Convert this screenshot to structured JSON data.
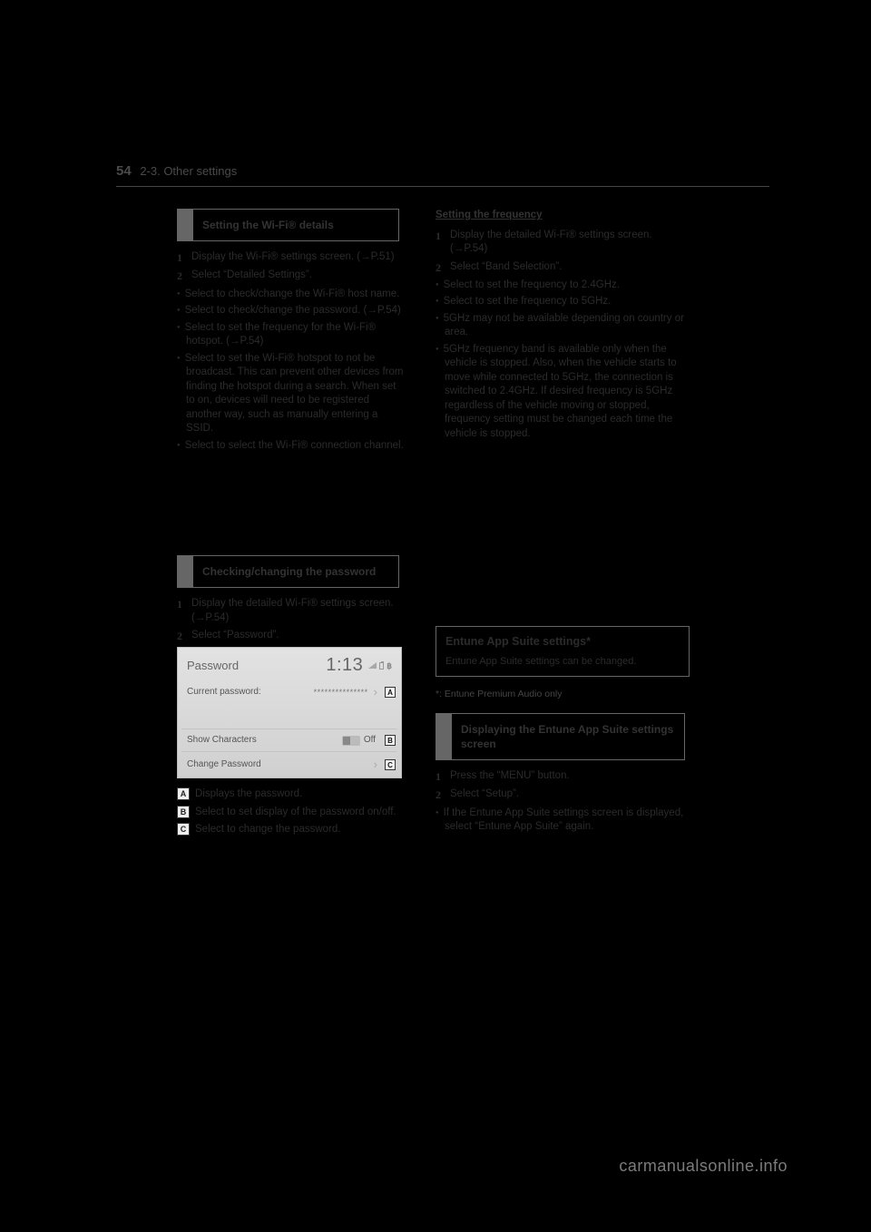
{
  "header": {
    "page_number": "54",
    "section": "2-3. Other settings"
  },
  "left": {
    "s1_title": "Setting the Wi-Fi® details",
    "s1_steps": [
      "Display the Wi-Fi® settings screen. (→P.51)",
      "Select “Detailed Settings”."
    ],
    "s1_bullets": [
      "Select to check/change the Wi-Fi® host name.",
      "Select to check/change the password. (→P.54)",
      "Select to set the frequency for the Wi-Fi® hotspot. (→P.54)",
      "Select to set the Wi-Fi® hotspot to not be broadcast. This can prevent other devices from finding the hotspot during a search. When set to on, devices will need to be registered another way, such as manually entering a SSID.",
      "Select to select the Wi-Fi® connection channel."
    ],
    "s2_title": "Checking/changing the password",
    "s2_steps": [
      "Display the detailed Wi-Fi® settings screen. (→P.54)",
      "Select “Password”."
    ],
    "inset": {
      "title": "Password",
      "time": "1:13",
      "row1_label": "Current password:",
      "row1_value": "***************",
      "row2_label": "Show Characters",
      "row2_value": "Off",
      "row3_label": "Change Password"
    },
    "callouts": [
      "Displays the password.",
      "Select to set display of the password on/off.",
      "Select to change the password."
    ]
  },
  "right": {
    "s1_title": "Setting the frequency",
    "s1_steps": [
      "Display the detailed Wi-Fi® settings screen. (→P.54)",
      "Select “Band Selection”."
    ],
    "s1_bullets": [
      "Select to set the frequency to 2.4GHz.",
      "Select to set the frequency to 5GHz."
    ],
    "info_lines": [
      "5GHz may not be available depending on country or area.",
      "5GHz frequency band is available only when the vehicle is stopped. Also, when the vehicle starts to move while connected to 5GHz, the connection is switched to 2.4GHz. If desired frequency is 5GHz regardless of the vehicle moving or stopped, frequency setting must be changed each time the vehicle is stopped."
    ],
    "s2_title": "Displaying the Entune App Suite settings screen",
    "s2_steps": [
      "Press the “MENU” button.",
      "Select “Setup”."
    ],
    "s2_bullet": "If the Entune App Suite settings screen is displayed, select “Entune App Suite” again.",
    "s3_group_title": "Entune App Suite settings*",
    "s3_group_body": "Entune App Suite settings can be changed.",
    "s3_footnote": "*: Entune Premium Audio only"
  },
  "footer": {
    "watermark": "carmanualsonline.info"
  }
}
